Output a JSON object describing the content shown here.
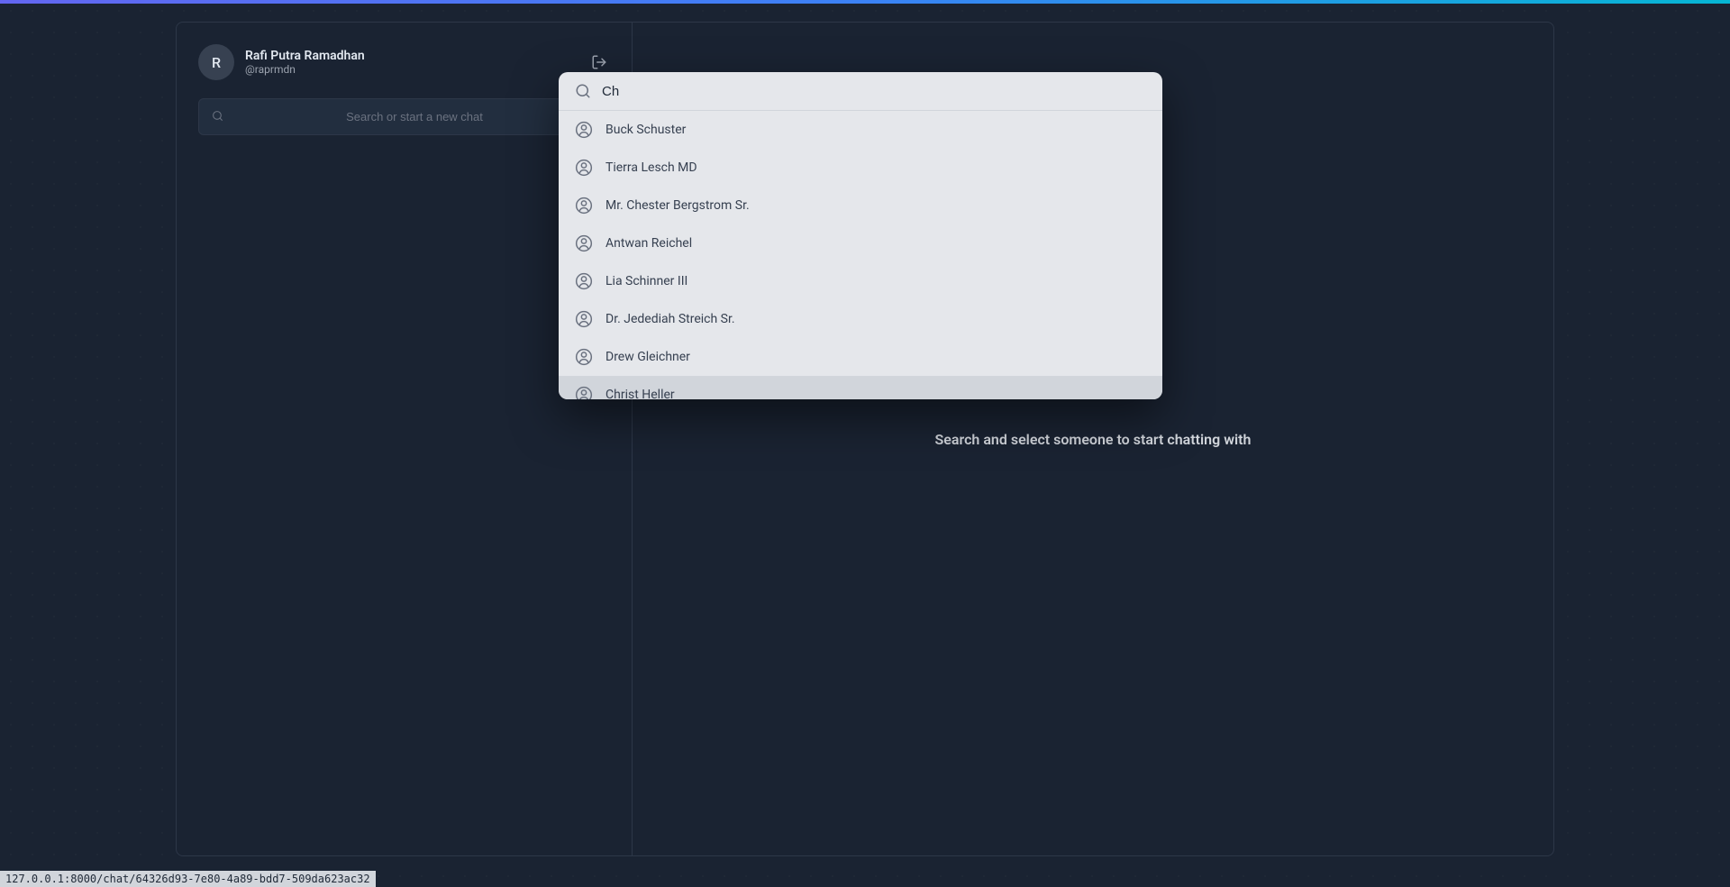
{
  "user": {
    "avatar_initial": "R",
    "name": "Rafi Putra Ramadhan",
    "handle": "@raprmdn"
  },
  "sidebar": {
    "search_placeholder": "Search or start a new chat"
  },
  "main": {
    "empty_state": "Search and select someone to start chatting with"
  },
  "modal": {
    "search_value": "Ch",
    "results": [
      {
        "name": "Buck Schuster"
      },
      {
        "name": "Tierra Lesch MD"
      },
      {
        "name": "Mr. Chester Bergstrom Sr."
      },
      {
        "name": "Antwan Reichel"
      },
      {
        "name": "Lia Schinner III"
      },
      {
        "name": "Dr. Jedediah Streich Sr."
      },
      {
        "name": "Drew Gleichner"
      },
      {
        "name": "Christ Heller"
      }
    ],
    "highlighted_index": 7
  },
  "status_bar": {
    "text": "127.0.0.1:8000/chat/64326d93-7e80-4a89-bdd7-509da623ac32"
  }
}
